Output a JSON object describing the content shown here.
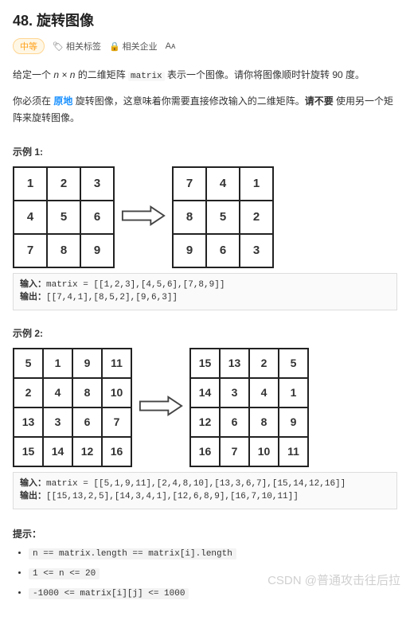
{
  "problem": {
    "title": "48. 旋转图像",
    "difficulty": "中等",
    "meta_tags_label": "相关标签",
    "meta_companies_label": "相关企业",
    "meta_font_label": "Aᴀ",
    "desc_prefix": "给定一个 ",
    "desc_n_times_n": "n × n",
    "desc_mid1": " 的二维矩阵 ",
    "desc_matrix_code": "matrix",
    "desc_tail1": " 表示一个图像。请你将图像顺时针旋转 90 度。",
    "desc2_prefix": "你必须在 ",
    "desc2_inplace": "原地",
    "desc2_mid": " 旋转图像，这意味着你需要直接修改输入的二维矩阵。",
    "desc2_bold": "请不要",
    "desc2_tail": " 使用另一个矩阵来旋转图像。"
  },
  "examples": [
    {
      "label": "示例 1:",
      "input_matrix": [
        [
          1,
          2,
          3
        ],
        [
          4,
          5,
          6
        ],
        [
          7,
          8,
          9
        ]
      ],
      "output_matrix": [
        [
          7,
          4,
          1
        ],
        [
          8,
          5,
          2
        ],
        [
          9,
          6,
          3
        ]
      ],
      "input_label": "输入：",
      "input_text": "matrix = [[1,2,3],[4,5,6],[7,8,9]]",
      "output_label": "输出：",
      "output_text": "[[7,4,1],[8,5,2],[9,6,3]]",
      "small": false
    },
    {
      "label": "示例 2:",
      "input_matrix": [
        [
          5,
          1,
          9,
          11
        ],
        [
          2,
          4,
          8,
          10
        ],
        [
          13,
          3,
          6,
          7
        ],
        [
          15,
          14,
          12,
          16
        ]
      ],
      "output_matrix": [
        [
          15,
          13,
          2,
          5
        ],
        [
          14,
          3,
          4,
          1
        ],
        [
          12,
          6,
          8,
          9
        ],
        [
          16,
          7,
          10,
          11
        ]
      ],
      "input_label": "输入：",
      "input_text": "matrix = [[5,1,9,11],[2,4,8,10],[13,3,6,7],[15,14,12,16]]",
      "output_label": "输出：",
      "output_text": "[[15,13,2,5],[14,3,4,1],[12,6,8,9],[16,7,10,11]]",
      "small": true
    }
  ],
  "constraints": {
    "label": "提示：",
    "items": [
      "n == matrix.length == matrix[i].length",
      "1 <= n <= 20",
      "-1000 <= matrix[i][j] <= 1000"
    ]
  },
  "watermark": "CSDN @普通攻击往后拉"
}
